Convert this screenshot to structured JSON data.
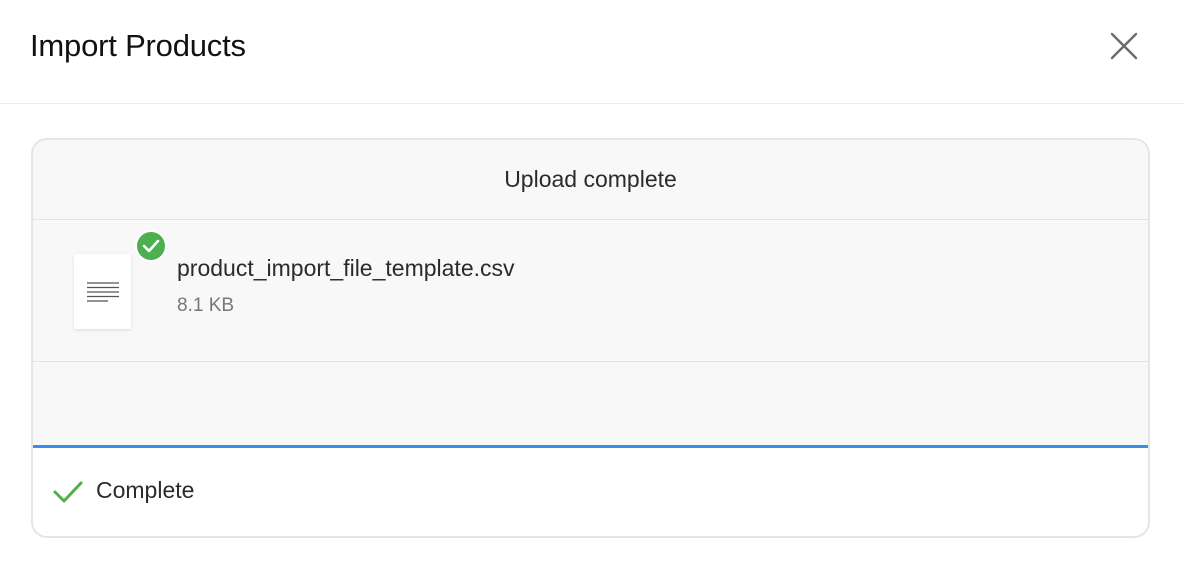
{
  "modal": {
    "title": "Import Products",
    "close_icon": "close-icon"
  },
  "upload": {
    "header": "Upload complete",
    "file": {
      "icon": "document-icon",
      "status_icon": "check-circle-icon",
      "name": "product_import_file_template.csv",
      "size": "8.1 KB"
    },
    "progress": {
      "percent": 100
    },
    "status": {
      "icon": "checkmark-icon",
      "label": "Complete"
    }
  },
  "colors": {
    "accent": "#3b8ee8",
    "success": "#4caf50",
    "panel_bg": "#f8f8f8",
    "border": "#e5e5e5"
  }
}
